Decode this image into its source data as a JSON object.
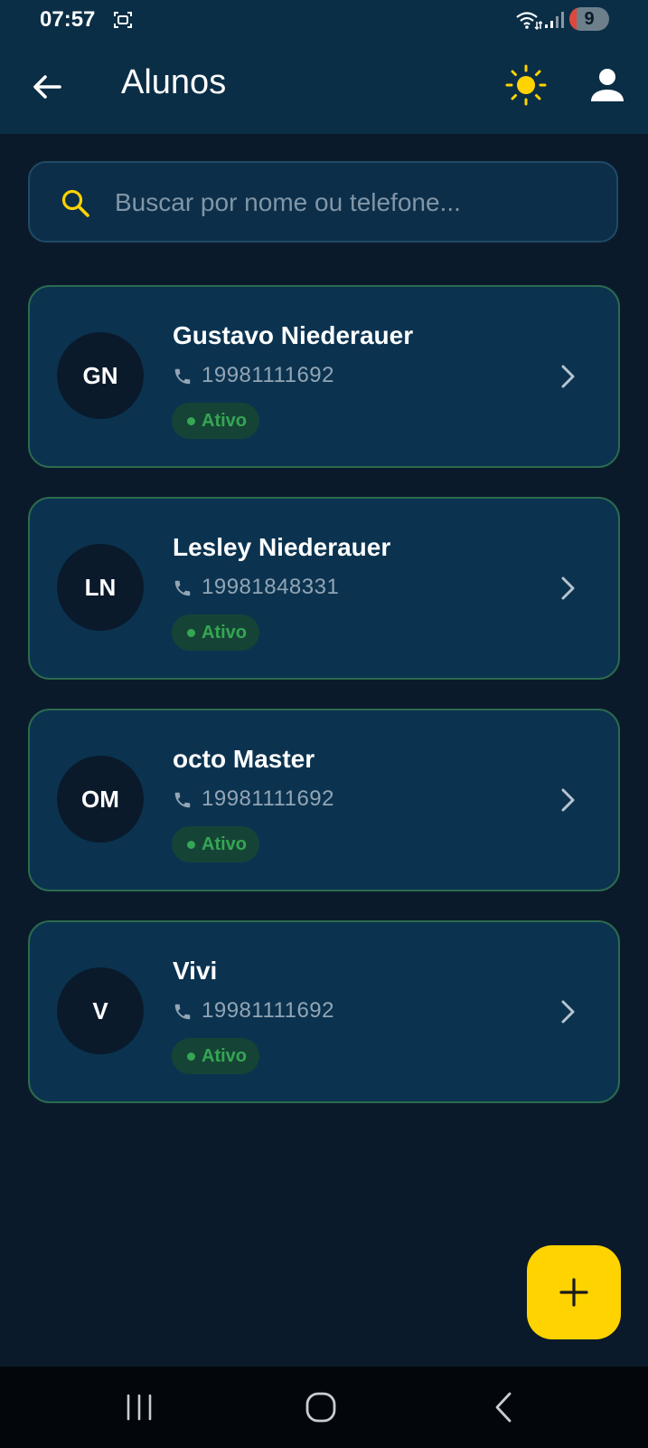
{
  "status_bar": {
    "time": "07:57",
    "battery_level": "9",
    "icons": [
      "screenshot-icon",
      "wifi-icon",
      "signal-icon",
      "battery-icon"
    ]
  },
  "app_bar": {
    "title": "Alunos",
    "back_icon": "arrow-left-icon",
    "theme_icon": "sun-icon",
    "profile_icon": "person-icon"
  },
  "search": {
    "placeholder": "Buscar por nome ou telefone...",
    "value": ""
  },
  "students": [
    {
      "initials": "GN",
      "name": "Gustavo Niederauer",
      "phone": "19981111692",
      "status": "Ativo"
    },
    {
      "initials": "LN",
      "name": "Lesley Niederauer",
      "phone": "19981848331",
      "status": "Ativo"
    },
    {
      "initials": "OM",
      "name": "octo Master",
      "phone": "19981111692",
      "status": "Ativo"
    },
    {
      "initials": "V",
      "name": "Vivi",
      "phone": "19981111692",
      "status": "Ativo"
    }
  ],
  "fab": {
    "icon": "plus-icon"
  },
  "colors": {
    "background": "#0b1a2a",
    "app_bar": "#0a2e46",
    "card": "#0b3350",
    "card_border": "#2a6b4e",
    "accent": "#ffd300",
    "status_active": "#35a653"
  },
  "nav_bar": {
    "icons": [
      "recents-icon",
      "home-icon",
      "back-icon"
    ]
  }
}
